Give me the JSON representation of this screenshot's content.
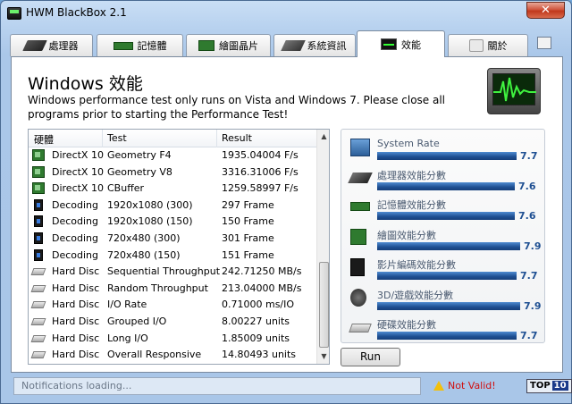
{
  "window": {
    "title": "HWM BlackBox 2.1",
    "close_label": "✕"
  },
  "tabs": [
    {
      "label": "處理器",
      "icon": "cpu-icon"
    },
    {
      "label": "記憶體",
      "icon": "memory-icon"
    },
    {
      "label": "繪圖晶片",
      "icon": "gpu-icon"
    },
    {
      "label": "系統資訊",
      "icon": "system-info-icon"
    },
    {
      "label": "效能",
      "icon": "performance-icon"
    },
    {
      "label": "關於",
      "icon": "about-icon"
    }
  ],
  "page": {
    "heading": "Windows 效能",
    "description": "Windows performance test only runs on Vista and Windows 7. Please close all programs prior to starting the Performance Test!"
  },
  "table": {
    "columns": [
      "硬體",
      "Test",
      "Result"
    ],
    "rows": [
      {
        "icon": "directx-icon",
        "hardware": "DirectX 10",
        "test": "Geometry F4",
        "result": "1935.04004 F/s"
      },
      {
        "icon": "directx-icon",
        "hardware": "DirectX 10",
        "test": "Geometry V8",
        "result": "3316.31006 F/s"
      },
      {
        "icon": "directx-icon",
        "hardware": "DirectX 10",
        "test": "CBuffer",
        "result": "1259.58997 F/s"
      },
      {
        "icon": "decoding-icon",
        "hardware": "Decoding",
        "test": "1920x1080 (300)",
        "result": "297 Frame"
      },
      {
        "icon": "decoding-icon",
        "hardware": "Decoding",
        "test": "1920x1080 (150)",
        "result": "150 Frame"
      },
      {
        "icon": "decoding-icon",
        "hardware": "Decoding",
        "test": "720x480 (300)",
        "result": "301 Frame"
      },
      {
        "icon": "decoding-icon",
        "hardware": "Decoding",
        "test": "720x480 (150)",
        "result": "151 Frame"
      },
      {
        "icon": "hard-disc-icon",
        "hardware": "Hard Disc",
        "test": "Sequential Throughput",
        "result": "242.71250 MB/s"
      },
      {
        "icon": "hard-disc-icon",
        "hardware": "Hard Disc",
        "test": "Random Throughput",
        "result": "213.04000 MB/s"
      },
      {
        "icon": "hard-disc-icon",
        "hardware": "Hard Disc",
        "test": "I/O Rate",
        "result": "0.71000 ms/IO"
      },
      {
        "icon": "hard-disc-icon",
        "hardware": "Hard Disc",
        "test": "Grouped I/O",
        "result": "8.00227 units"
      },
      {
        "icon": "hard-disc-icon",
        "hardware": "Hard Disc",
        "test": "Long I/O",
        "result": "1.85009 units"
      },
      {
        "icon": "hard-disc-icon",
        "hardware": "Hard Disc",
        "test": "Overall Responsive",
        "result": "14.80493 units"
      }
    ]
  },
  "scores": [
    {
      "label": "System Rate",
      "value": "7.7",
      "fraction": 0.977,
      "icon": "system-rate-icon"
    },
    {
      "label": "處理器效能分數",
      "value": "7.6",
      "fraction": 0.965,
      "icon": "cpu-icon"
    },
    {
      "label": "記憶體效能分數",
      "value": "7.6",
      "fraction": 0.965,
      "icon": "memory-icon"
    },
    {
      "label": "繪圖效能分數",
      "value": "7.9",
      "fraction": 1.0,
      "icon": "gpu-icon"
    },
    {
      "label": "影片編碼效能分數",
      "value": "7.7",
      "fraction": 0.977,
      "icon": "video-encode-icon"
    },
    {
      "label": "3D/遊戲效能分數",
      "value": "7.9",
      "fraction": 1.0,
      "icon": "gaming-icon"
    },
    {
      "label": "硬碟效能分數",
      "value": "7.7",
      "fraction": 0.977,
      "icon": "hard-disk-icon"
    }
  ],
  "run_button": "Run",
  "status": {
    "message": "Notifications loading...",
    "validity": "Not Valid!",
    "logo_prefix": "TOP",
    "logo_number": "10"
  },
  "colors": {
    "bar": "#1e4f92",
    "invalid": "#d01010"
  }
}
